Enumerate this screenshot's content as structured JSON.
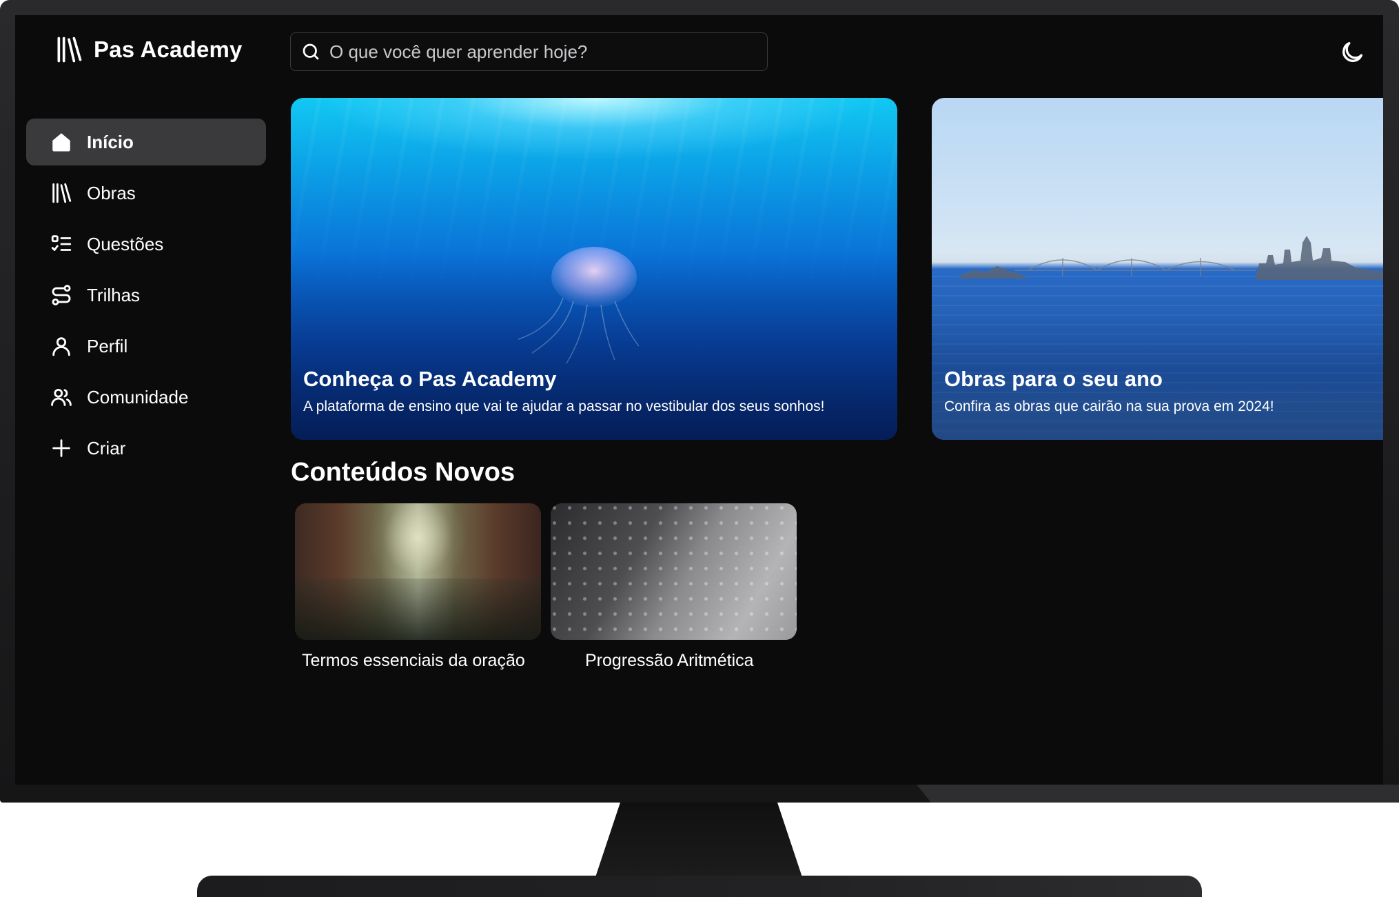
{
  "app": {
    "name": "Pas Academy"
  },
  "search": {
    "placeholder": "O que você quer aprender hoje?"
  },
  "sidebar": {
    "items": [
      {
        "label": "Início",
        "icon": "home-icon",
        "active": true
      },
      {
        "label": "Obras",
        "icon": "books-icon",
        "active": false
      },
      {
        "label": "Questões",
        "icon": "list-check-icon",
        "active": false
      },
      {
        "label": "Trilhas",
        "icon": "route-icon",
        "active": false
      },
      {
        "label": "Perfil",
        "icon": "user-icon",
        "active": false
      },
      {
        "label": "Comunidade",
        "icon": "users-icon",
        "active": false
      },
      {
        "label": "Criar",
        "icon": "plus-icon",
        "active": false
      }
    ]
  },
  "hero": [
    {
      "title": "Conheça o Pas Academy",
      "subtitle": "A plataforma de ensino que vai te ajudar a passar no vestibular dos seus sonhos!"
    },
    {
      "title": "Obras para o seu ano",
      "subtitle": "Confira as obras que cairão na sua prova em 2024!"
    }
  ],
  "section": {
    "title": "Conteúdos Novos",
    "items": [
      {
        "label": "Termos essenciais da oração"
      },
      {
        "label": "Progressão Aritmética"
      }
    ]
  },
  "theme": {
    "icon": "moon-icon"
  },
  "colors": {
    "background": "#0b0b0c",
    "active_item": "#3a3a3c",
    "text": "#ffffff"
  }
}
